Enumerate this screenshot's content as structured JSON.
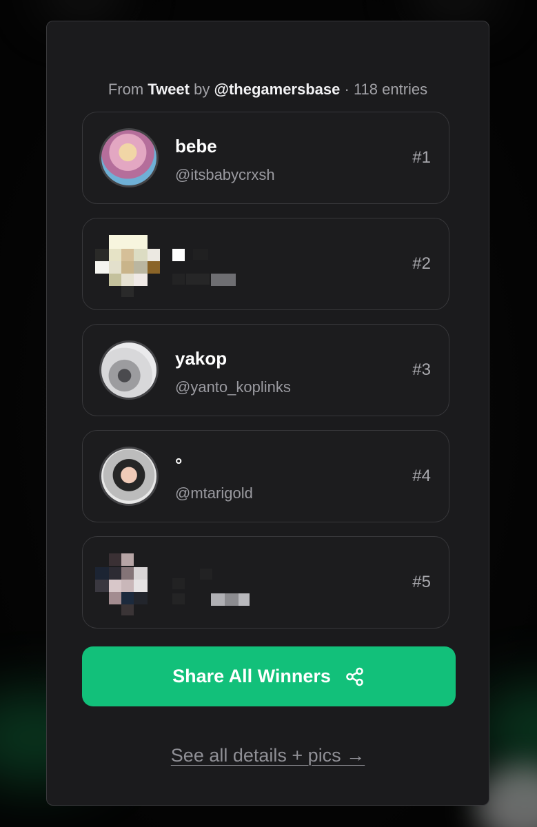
{
  "source": {
    "prefix": "From",
    "platform": "Tweet",
    "by": "by",
    "account": "@thegamersbase",
    "separator": "·",
    "entries": "118 entries"
  },
  "winners": [
    {
      "name": "bebe",
      "handle": "@itsbabycrxsh",
      "rank": "#1"
    },
    {
      "name": "",
      "handle": "",
      "rank": "#2",
      "redacted": true
    },
    {
      "name": "yakop",
      "handle": "@yanto_koplinks",
      "rank": "#3"
    },
    {
      "name": "°",
      "handle": "@mtarigold",
      "rank": "#4"
    },
    {
      "name": "",
      "handle": "",
      "rank": "#5",
      "redacted": true
    }
  ],
  "share_button": {
    "label": "Share All Winners",
    "icon": "share-icon"
  },
  "details_link": {
    "label": "See all details + pics →"
  },
  "colors": {
    "accent": "#12c07a",
    "card": "#1b1b1d",
    "text_muted": "#a3a3a8"
  }
}
